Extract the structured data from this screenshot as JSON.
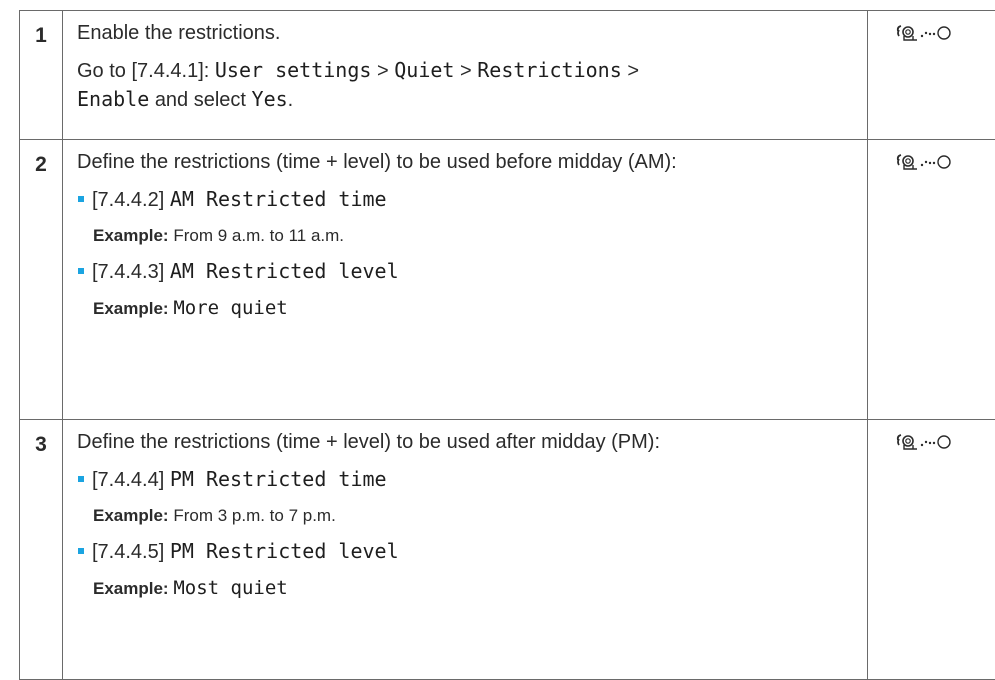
{
  "rows": [
    {
      "number": "1",
      "title": "Enable the restrictions.",
      "path_prefix": "Go to [7.4.4.1]:",
      "path_items": [
        "User settings",
        "Quiet",
        "Restrictions",
        "Enable"
      ],
      "separator": ">",
      "path_suffix": "and select",
      "path_value": "Yes",
      "period": ".",
      "icon": "remote-controller-icon"
    },
    {
      "number": "2",
      "title": "Define the restrictions (time + level) to be used before midday (AM):",
      "items": [
        {
          "code": "[7.4.4.2]",
          "name": "AM Restricted time",
          "example_label": "Example:",
          "example_text": "From 9 a.m. to 11 a.m."
        },
        {
          "code": "[7.4.4.3]",
          "name": "AM Restricted level",
          "example_label": "Example:",
          "example_value": "More quiet"
        }
      ],
      "icon": "remote-controller-icon"
    },
    {
      "number": "3",
      "title": "Define the restrictions (time + level) to be used after midday (PM):",
      "items": [
        {
          "code": "[7.4.4.4]",
          "name": "PM Restricted time",
          "example_label": "Example:",
          "example_text": "From 3 p.m. to 7 p.m."
        },
        {
          "code": "[7.4.4.5]",
          "name": "PM Restricted level",
          "example_label": "Example:",
          "example_value": "Most quiet"
        }
      ],
      "icon": "remote-controller-icon"
    }
  ],
  "colors": {
    "bullet": "#1ba4e1",
    "border": "#6a6a6a",
    "text": "#2b2b2b"
  }
}
